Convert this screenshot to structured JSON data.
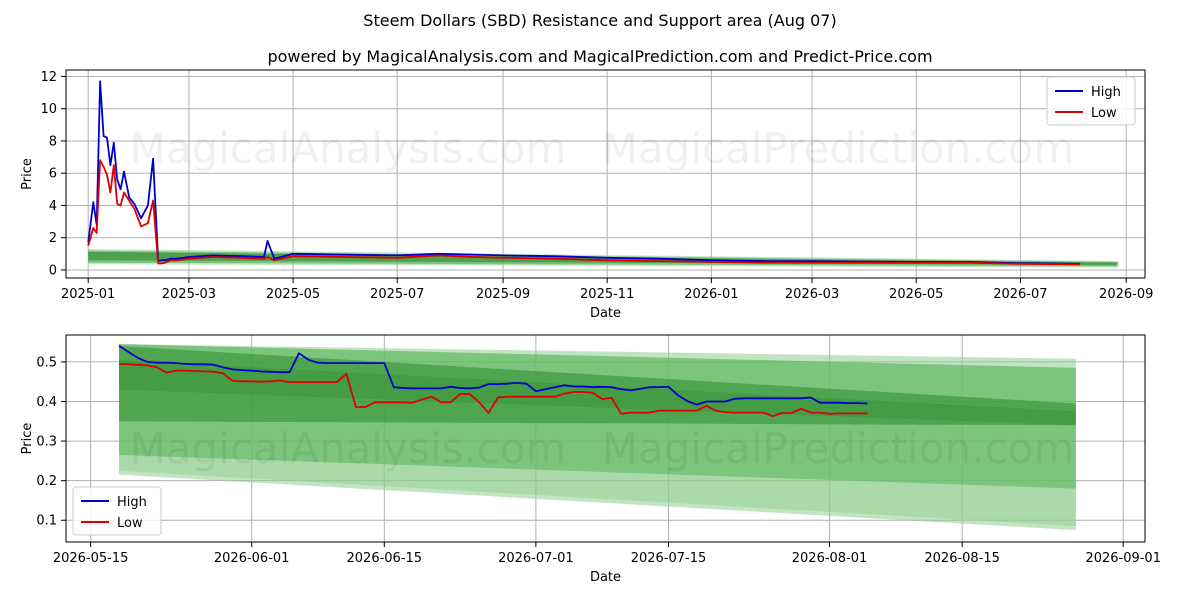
{
  "title": "Steem Dollars (SBD) Resistance and Support area (Aug 07)",
  "subtitle": "powered by MagicalAnalysis.com and MagicalPrediction.com and Predict-Price.com",
  "watermarks": [
    "MagicalAnalysis.com",
    "MagicalPrediction.com"
  ],
  "colors": {
    "high": "#0000cc",
    "low": "#dd0000",
    "band_dark": "#2e8b2e",
    "band_mid": "#4caf50",
    "band_light": "#8fce8f",
    "grid": "#b0b0b0"
  },
  "chart_data": [
    {
      "type": "line",
      "xlabel": "Date",
      "ylabel": "Price",
      "xticks": [
        "2025-01",
        "2025-03",
        "2025-05",
        "2025-07",
        "2025-09",
        "2025-11",
        "2026-01",
        "2026-03",
        "2026-05",
        "2026-07",
        "2026-09"
      ],
      "yticks": [
        "0",
        "2",
        "4",
        "6",
        "8",
        "10",
        "12"
      ],
      "ylim": [
        -0.5,
        12.4
      ],
      "grid": true,
      "legend": "top-right",
      "series": [
        {
          "name": "High",
          "x": [
            "2025-01-01",
            "2025-01-04",
            "2025-01-06",
            "2025-01-08",
            "2025-01-10",
            "2025-01-12",
            "2025-01-14",
            "2025-01-16",
            "2025-01-18",
            "2025-01-20",
            "2025-01-22",
            "2025-01-25",
            "2025-01-28",
            "2025-02-01",
            "2025-02-05",
            "2025-02-08",
            "2025-02-11",
            "2025-02-13",
            "2025-02-15",
            "2025-02-18",
            "2025-02-22",
            "2025-03-01",
            "2025-03-15",
            "2025-04-01",
            "2025-04-14",
            "2025-04-16",
            "2025-04-20",
            "2025-05-01",
            "2025-06-01",
            "2025-07-01",
            "2025-07-25",
            "2025-08-15",
            "2025-09-01",
            "2025-10-01",
            "2025-11-01",
            "2025-12-01",
            "2026-01-01",
            "2026-02-01",
            "2026-03-01",
            "2026-04-01",
            "2026-05-01",
            "2026-06-01",
            "2026-07-01",
            "2026-08-05"
          ],
          "values": [
            1.7,
            4.2,
            2.8,
            11.7,
            8.3,
            8.2,
            6.5,
            7.9,
            5.6,
            5.0,
            6.1,
            4.5,
            4.1,
            3.2,
            4.0,
            6.9,
            0.55,
            0.6,
            0.6,
            0.7,
            0.7,
            0.8,
            0.9,
            0.85,
            0.8,
            1.8,
            0.7,
            1.0,
            0.95,
            0.9,
            1.0,
            0.95,
            0.9,
            0.85,
            0.75,
            0.7,
            0.6,
            0.55,
            0.55,
            0.52,
            0.5,
            0.5,
            0.42,
            0.38
          ]
        },
        {
          "name": "Low",
          "x": [
            "2025-01-01",
            "2025-01-04",
            "2025-01-06",
            "2025-01-08",
            "2025-01-10",
            "2025-01-12",
            "2025-01-14",
            "2025-01-16",
            "2025-01-18",
            "2025-01-20",
            "2025-01-22",
            "2025-01-25",
            "2025-01-28",
            "2025-02-01",
            "2025-02-05",
            "2025-02-08",
            "2025-02-11",
            "2025-02-13",
            "2025-02-15",
            "2025-02-18",
            "2025-02-22",
            "2025-03-01",
            "2025-03-15",
            "2025-04-01",
            "2025-04-14",
            "2025-04-16",
            "2025-04-20",
            "2025-05-01",
            "2025-06-01",
            "2025-07-01",
            "2025-07-25",
            "2025-08-15",
            "2025-09-01",
            "2025-10-01",
            "2025-11-01",
            "2025-12-01",
            "2026-01-01",
            "2026-02-01",
            "2026-03-01",
            "2026-04-01",
            "2026-05-01",
            "2026-06-01",
            "2026-07-01",
            "2026-08-05"
          ],
          "values": [
            1.5,
            2.6,
            2.3,
            6.8,
            6.4,
            5.9,
            4.8,
            6.5,
            4.1,
            4.0,
            4.8,
            4.3,
            3.8,
            2.7,
            2.9,
            4.3,
            0.4,
            0.4,
            0.45,
            0.6,
            0.6,
            0.7,
            0.8,
            0.75,
            0.7,
            0.8,
            0.6,
            0.85,
            0.8,
            0.75,
            0.9,
            0.8,
            0.75,
            0.7,
            0.6,
            0.55,
            0.5,
            0.45,
            0.45,
            0.45,
            0.45,
            0.45,
            0.38,
            0.35
          ]
        }
      ]
    },
    {
      "type": "line",
      "xlabel": "Date",
      "ylabel": "Price",
      "xticks": [
        "2026-05-15",
        "2026-06-01",
        "2026-06-15",
        "2026-07-01",
        "2026-07-15",
        "2026-08-01",
        "2026-08-15",
        "2026-09-01"
      ],
      "yticks": [
        "0.1",
        "0.2",
        "0.3",
        "0.4",
        "0.5"
      ],
      "ylim": [
        0.045,
        0.568
      ],
      "grid": true,
      "legend": "bottom-left",
      "series": [
        {
          "name": "High",
          "x": [
            "2026-05-18",
            "2026-05-19",
            "2026-05-20",
            "2026-05-21",
            "2026-05-22",
            "2026-05-23",
            "2026-05-24",
            "2026-05-25",
            "2026-05-26",
            "2026-05-27",
            "2026-05-28",
            "2026-05-29",
            "2026-05-30",
            "2026-05-31",
            "2026-06-01",
            "2026-06-02",
            "2026-06-03",
            "2026-06-04",
            "2026-06-05",
            "2026-06-06",
            "2026-06-07",
            "2026-06-08",
            "2026-06-09",
            "2026-06-10",
            "2026-06-11",
            "2026-06-12",
            "2026-06-13",
            "2026-06-14",
            "2026-06-15",
            "2026-06-16",
            "2026-06-17",
            "2026-06-18",
            "2026-06-19",
            "2026-06-20",
            "2026-06-21",
            "2026-06-22",
            "2026-06-23",
            "2026-06-24",
            "2026-06-25",
            "2026-06-26",
            "2026-06-27",
            "2026-06-28",
            "2026-06-29",
            "2026-06-30",
            "2026-07-01",
            "2026-07-02",
            "2026-07-03",
            "2026-07-04",
            "2026-07-05",
            "2026-07-06",
            "2026-07-07",
            "2026-07-08",
            "2026-07-09",
            "2026-07-10",
            "2026-07-11",
            "2026-07-12",
            "2026-07-13",
            "2026-07-14",
            "2026-07-15",
            "2026-07-16",
            "2026-07-17",
            "2026-07-18",
            "2026-07-19",
            "2026-07-20",
            "2026-07-21",
            "2026-07-22",
            "2026-07-23",
            "2026-07-24",
            "2026-07-25",
            "2026-07-26",
            "2026-07-27",
            "2026-07-28",
            "2026-07-29",
            "2026-07-30",
            "2026-07-31",
            "2026-08-01",
            "2026-08-02",
            "2026-08-03",
            "2026-08-04",
            "2026-08-05"
          ],
          "values": [
            0.541,
            0.525,
            0.51,
            0.5,
            0.498,
            0.498,
            0.497,
            0.495,
            0.494,
            0.494,
            0.493,
            0.486,
            0.481,
            0.479,
            0.478,
            0.476,
            0.475,
            0.474,
            0.474,
            0.522,
            0.505,
            0.498,
            0.497,
            0.497,
            0.497,
            0.497,
            0.497,
            0.497,
            0.497,
            0.436,
            0.434,
            0.433,
            0.433,
            0.433,
            0.433,
            0.437,
            0.434,
            0.433,
            0.435,
            0.444,
            0.444,
            0.445,
            0.447,
            0.445,
            0.426,
            0.431,
            0.436,
            0.441,
            0.438,
            0.438,
            0.436,
            0.437,
            0.436,
            0.431,
            0.428,
            0.432,
            0.436,
            0.436,
            0.437,
            0.416,
            0.401,
            0.392,
            0.4,
            0.4,
            0.4,
            0.407,
            0.408,
            0.408,
            0.408,
            0.408,
            0.408,
            0.408,
            0.408,
            0.41,
            0.397,
            0.397,
            0.397,
            0.396,
            0.396,
            0.395
          ]
        },
        {
          "name": "Low",
          "x": [
            "2026-05-18",
            "2026-05-19",
            "2026-05-20",
            "2026-05-21",
            "2026-05-22",
            "2026-05-23",
            "2026-05-24",
            "2026-05-25",
            "2026-05-26",
            "2026-05-27",
            "2026-05-28",
            "2026-05-29",
            "2026-05-30",
            "2026-05-31",
            "2026-06-01",
            "2026-06-02",
            "2026-06-03",
            "2026-06-04",
            "2026-06-05",
            "2026-06-06",
            "2026-06-07",
            "2026-06-08",
            "2026-06-09",
            "2026-06-10",
            "2026-06-11",
            "2026-06-12",
            "2026-06-13",
            "2026-06-14",
            "2026-06-15",
            "2026-06-16",
            "2026-06-17",
            "2026-06-18",
            "2026-06-19",
            "2026-06-20",
            "2026-06-21",
            "2026-06-22",
            "2026-06-23",
            "2026-06-24",
            "2026-06-25",
            "2026-06-26",
            "2026-06-27",
            "2026-06-28",
            "2026-06-29",
            "2026-06-30",
            "2026-07-01",
            "2026-07-02",
            "2026-07-03",
            "2026-07-04",
            "2026-07-05",
            "2026-07-06",
            "2026-07-07",
            "2026-07-08",
            "2026-07-09",
            "2026-07-10",
            "2026-07-11",
            "2026-07-12",
            "2026-07-13",
            "2026-07-14",
            "2026-07-15",
            "2026-07-16",
            "2026-07-17",
            "2026-07-18",
            "2026-07-19",
            "2026-07-20",
            "2026-07-21",
            "2026-07-22",
            "2026-07-23",
            "2026-07-24",
            "2026-07-25",
            "2026-07-26",
            "2026-07-27",
            "2026-07-28",
            "2026-07-29",
            "2026-07-30",
            "2026-07-31",
            "2026-08-01",
            "2026-08-02",
            "2026-08-03",
            "2026-08-04",
            "2026-08-05"
          ],
          "values": [
            0.495,
            0.494,
            0.493,
            0.491,
            0.487,
            0.473,
            0.478,
            0.478,
            0.477,
            0.476,
            0.475,
            0.471,
            0.452,
            0.451,
            0.451,
            0.45,
            0.451,
            0.453,
            0.449,
            0.449,
            0.449,
            0.449,
            0.449,
            0.449,
            0.47,
            0.386,
            0.386,
            0.398,
            0.398,
            0.398,
            0.398,
            0.397,
            0.405,
            0.412,
            0.398,
            0.398,
            0.419,
            0.419,
            0.399,
            0.371,
            0.41,
            0.412,
            0.412,
            0.412,
            0.412,
            0.412,
            0.412,
            0.42,
            0.424,
            0.424,
            0.422,
            0.406,
            0.409,
            0.369,
            0.372,
            0.372,
            0.372,
            0.377,
            0.377,
            0.377,
            0.377,
            0.377,
            0.389,
            0.377,
            0.373,
            0.372,
            0.372,
            0.372,
            0.372,
            0.363,
            0.371,
            0.371,
            0.382,
            0.372,
            0.372,
            0.369,
            0.37,
            0.37,
            0.37,
            0.37
          ]
        }
      ]
    }
  ],
  "legend": {
    "high_label": "High",
    "low_label": "Low"
  }
}
